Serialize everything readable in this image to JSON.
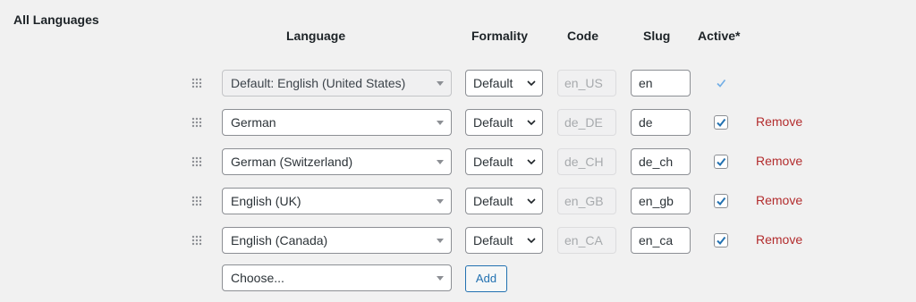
{
  "section": {
    "title": "All Languages"
  },
  "columns": {
    "language": "Language",
    "formality": "Formality",
    "code": "Code",
    "slug": "Slug",
    "active": "Active*"
  },
  "rows": [
    {
      "language": "Default: English (United States)",
      "formality": "Default",
      "code": "en_US",
      "slug": "en",
      "is_default": true,
      "active": true
    },
    {
      "language": "German",
      "formality": "Default",
      "code": "de_DE",
      "slug": "de",
      "is_default": false,
      "active": true,
      "remove": "Remove"
    },
    {
      "language": "German (Switzerland)",
      "formality": "Default",
      "code": "de_CH",
      "slug": "de_ch",
      "is_default": false,
      "active": true,
      "remove": "Remove"
    },
    {
      "language": "English (UK)",
      "formality": "Default",
      "code": "en_GB",
      "slug": "en_gb",
      "is_default": false,
      "active": true,
      "remove": "Remove"
    },
    {
      "language": "English (Canada)",
      "formality": "Default",
      "code": "en_CA",
      "slug": "en_ca",
      "is_default": false,
      "active": true,
      "remove": "Remove"
    }
  ],
  "new_row": {
    "placeholder": "Choose...",
    "add_label": "Add"
  },
  "colors": {
    "accent": "#2271b1",
    "danger": "#b32d2e",
    "check": "#2271b1",
    "default_check": "#72aee6"
  },
  "icons": {
    "drag": "drag-handle-icon",
    "caret": "caret-down-icon",
    "chevron": "chevron-down-icon",
    "check": "checkmark-icon"
  }
}
